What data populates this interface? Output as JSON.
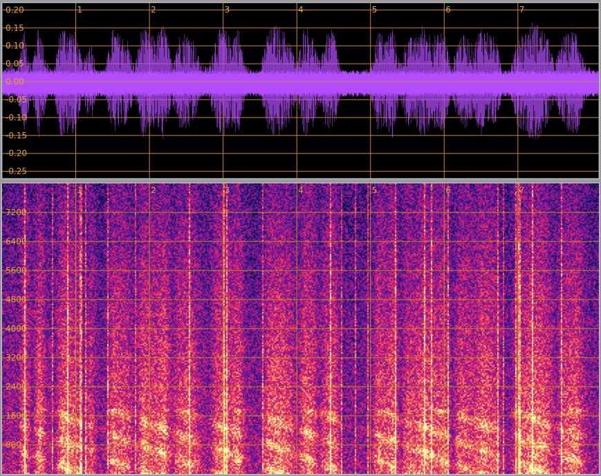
{
  "chart_data": [
    {
      "type": "line",
      "title": "",
      "xlabel": "",
      "ylabel": "",
      "ylim": [
        -0.27,
        0.22
      ],
      "yticks": [
        "0.20",
        "0.15",
        "0.10",
        "0.05",
        "0.00",
        "-0.05",
        "-0.10",
        "-0.15",
        "-0.20",
        "-0.25"
      ],
      "ytick_values": [
        0.2,
        0.15,
        0.1,
        0.05,
        0.0,
        -0.05,
        -0.1,
        -0.15,
        -0.2,
        -0.25
      ],
      "markers": [
        "1",
        "2",
        "3",
        "4",
        "5",
        "6",
        "7"
      ],
      "marker_seconds": [
        1,
        2,
        3,
        4,
        5,
        6,
        7
      ],
      "xlim_seconds": [
        0,
        8.1
      ],
      "grid": true,
      "series": [
        {
          "color": "#b44dff",
          "envelope_seconds": [
            0.0,
            0.1,
            0.2,
            0.3,
            0.4,
            0.5,
            0.6,
            0.7,
            0.8,
            0.9,
            1.0,
            1.1,
            1.2,
            1.3,
            1.4,
            1.5,
            1.6,
            1.7,
            1.8,
            1.9,
            2.0,
            2.1,
            2.2,
            2.3,
            2.4,
            2.5,
            2.6,
            2.7,
            2.8,
            2.9,
            3.0,
            3.1,
            3.2,
            3.3,
            3.4,
            3.5,
            3.6,
            3.7,
            3.8,
            3.9,
            4.0,
            4.1,
            4.2,
            4.3,
            4.4,
            4.5,
            4.6,
            4.7,
            4.8,
            4.9,
            5.0,
            5.1,
            5.2,
            5.3,
            5.4,
            5.5,
            5.6,
            5.7,
            5.8,
            5.9,
            6.0,
            6.1,
            6.2,
            6.3,
            6.4,
            6.5,
            6.6,
            6.7,
            6.8,
            6.9,
            7.0,
            7.1,
            7.2,
            7.3,
            7.4,
            7.5,
            7.6,
            7.7,
            7.8,
            7.9,
            8.0
          ],
          "envelope_amplitude": [
            0.03,
            0.05,
            0.04,
            0.15,
            0.04,
            0.17,
            0.06,
            0.03,
            0.16,
            0.15,
            0.14,
            0.05,
            0.12,
            0.03,
            0.04,
            0.15,
            0.13,
            0.12,
            0.04,
            0.16,
            0.13,
            0.13,
            0.17,
            0.06,
            0.13,
            0.14,
            0.12,
            0.05,
            0.04,
            0.13,
            0.16,
            0.12,
            0.16,
            0.05,
            0.03,
            0.03,
            0.14,
            0.16,
            0.15,
            0.12,
            0.05,
            0.16,
            0.14,
            0.06,
            0.13,
            0.15,
            0.03,
            0.03,
            0.03,
            0.03,
            0.04,
            0.15,
            0.12,
            0.16,
            0.05,
            0.13,
            0.12,
            0.16,
            0.14,
            0.13,
            0.15,
            0.04,
            0.13,
            0.13,
            0.1,
            0.16,
            0.14,
            0.12,
            0.03,
            0.04,
            0.13,
            0.14,
            0.17,
            0.16,
            0.13,
            0.05,
            0.12,
            0.14,
            0.15,
            0.06,
            0.03
          ]
        }
      ]
    },
    {
      "type": "heatmap",
      "title": "",
      "xlabel": "",
      "ylabel": "",
      "ylim": [
        0,
        8000
      ],
      "yticks": [
        "7200",
        "6400",
        "5600",
        "4800",
        "4000",
        "3200",
        "2400",
        "1600",
        "800"
      ],
      "ytick_values": [
        7200,
        6400,
        5600,
        4800,
        4000,
        3200,
        2400,
        1600,
        800
      ],
      "markers": [
        "1",
        "2",
        "3",
        "4",
        "5",
        "6",
        "7"
      ],
      "marker_seconds": [
        1,
        2,
        3,
        4,
        5,
        6,
        7
      ],
      "xlim_seconds": [
        0,
        8.1
      ],
      "grid": true,
      "colormap": [
        "#000010",
        "#1a1060",
        "#3a1890",
        "#6a1a90",
        "#a01890",
        "#d02070",
        "#f04060",
        "#ff8060",
        "#ffd080",
        "#ffffb0"
      ]
    }
  ]
}
